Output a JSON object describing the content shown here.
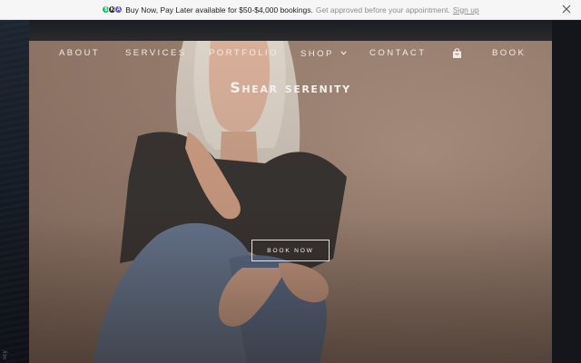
{
  "banner": {
    "badges": [
      "$",
      "K",
      "A"
    ],
    "main_text": "Buy Now, Pay Later available for $50-$4,000 bookings.",
    "sub_text": "Get approved before your appointment.",
    "signup_label": "Sign up",
    "close_icon": "close-icon"
  },
  "nav": {
    "items": {
      "about": "ABOUT",
      "services": "SERVICES",
      "portfolio": "PORTFOLIO",
      "shop": "SHOP",
      "contact": "CONTACT",
      "book": "BOOK"
    },
    "cart_icon": "shopping-bag-icon",
    "shop_dropdown_icon": "chevron-down-icon"
  },
  "hero": {
    "title": "Shear serenity",
    "cta_label": "BOOK NOW"
  },
  "side": {
    "vertical_text": "licy"
  },
  "colors": {
    "banner_bg": "#f6f6f6",
    "page_bg": "#111218",
    "hero_bg": "#9e8373",
    "nav_text": "#f2ece6",
    "badge_green": "#23b36a",
    "badge_purple": "#5b4fd8"
  }
}
